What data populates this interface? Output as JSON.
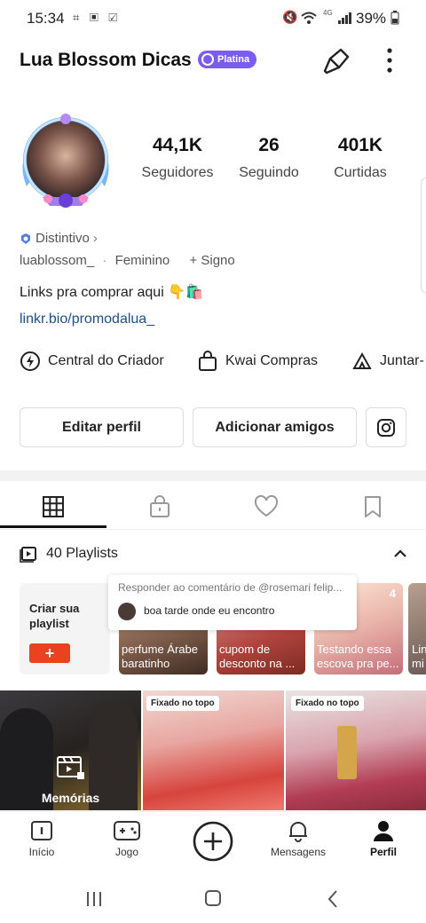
{
  "status_bar": {
    "time": "15:34",
    "battery": "39%",
    "network": "4G"
  },
  "profile": {
    "name": "Lua Blossom Dicas",
    "badge": "Platina",
    "stats": [
      {
        "value": "44,1K",
        "label": "Seguidores"
      },
      {
        "value": "26",
        "label": "Seguindo"
      },
      {
        "value": "401K",
        "label": "Curtidas"
      }
    ],
    "distintivo": "Distintivo",
    "username": "luablossom_",
    "gender": "Feminino",
    "signo": "+ Signo",
    "bio": "Links pra comprar aqui",
    "bio_emoji": "👇🛍️",
    "link": "linkr.bio/promodalua_"
  },
  "shortcuts": [
    "Central do Criador",
    "Kwai Compras",
    "Juntar-"
  ],
  "buttons": {
    "edit": "Editar perfil",
    "add_friends": "Adicionar amigos"
  },
  "playlists": {
    "title": "40 Playlists",
    "create_label": "Criar sua playlist",
    "create_btn": "+",
    "cards": [
      {
        "title": "perfume Árabe baratinho"
      },
      {
        "title": "cupom de desconto na ..."
      },
      {
        "title": "Testando essa escova pra pe...",
        "count": "4"
      },
      {
        "title": "Lin mi"
      }
    ]
  },
  "comment_popup": {
    "reply_to": "Responder ao comentário de @rosemari felip...",
    "text": "boa tarde onde eu encontro"
  },
  "videos": [
    {
      "label": "Memórias"
    },
    {
      "pin": "Fixado no topo"
    },
    {
      "pin": "Fixado no topo"
    }
  ],
  "nav": {
    "inicio": "Início",
    "jogo": "Jogo",
    "mensagens": "Mensagens",
    "perfil": "Perfil"
  },
  "colors": {
    "accent": "#7a5cf0",
    "link": "#1f4e8c",
    "create_btn": "#e8421e"
  }
}
